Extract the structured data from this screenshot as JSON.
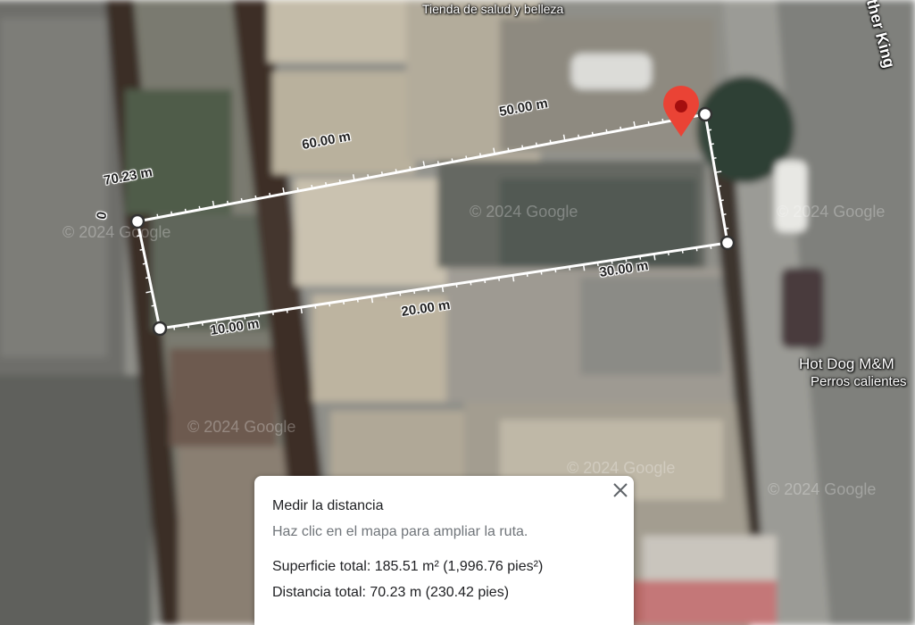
{
  "map": {
    "pois": [
      {
        "name": "Tienda de salud y belleza"
      },
      {
        "name": "ther King"
      },
      {
        "name": "Hot Dog M&M",
        "subtitle": "Perros calientes"
      }
    ],
    "watermark": "© 2024 Google",
    "measure_labels": {
      "total": "70.23 m",
      "zero": "0",
      "m10": "10.00 m",
      "m20": "20.00 m",
      "m30": "30.00 m",
      "m50": "50.00 m",
      "m60": "60.00 m"
    },
    "pin_color": "#ea4335",
    "line_color": "#ffffff"
  },
  "panel": {
    "title": "Medir la distancia",
    "subtitle": "Haz clic en el mapa para ampliar la ruta.",
    "area": "Superficie total: 185.51 m² (1,996.76 pies²)",
    "distance": "Distancia total: 70.23 m (230.42 pies)",
    "close_icon": "close-icon"
  }
}
